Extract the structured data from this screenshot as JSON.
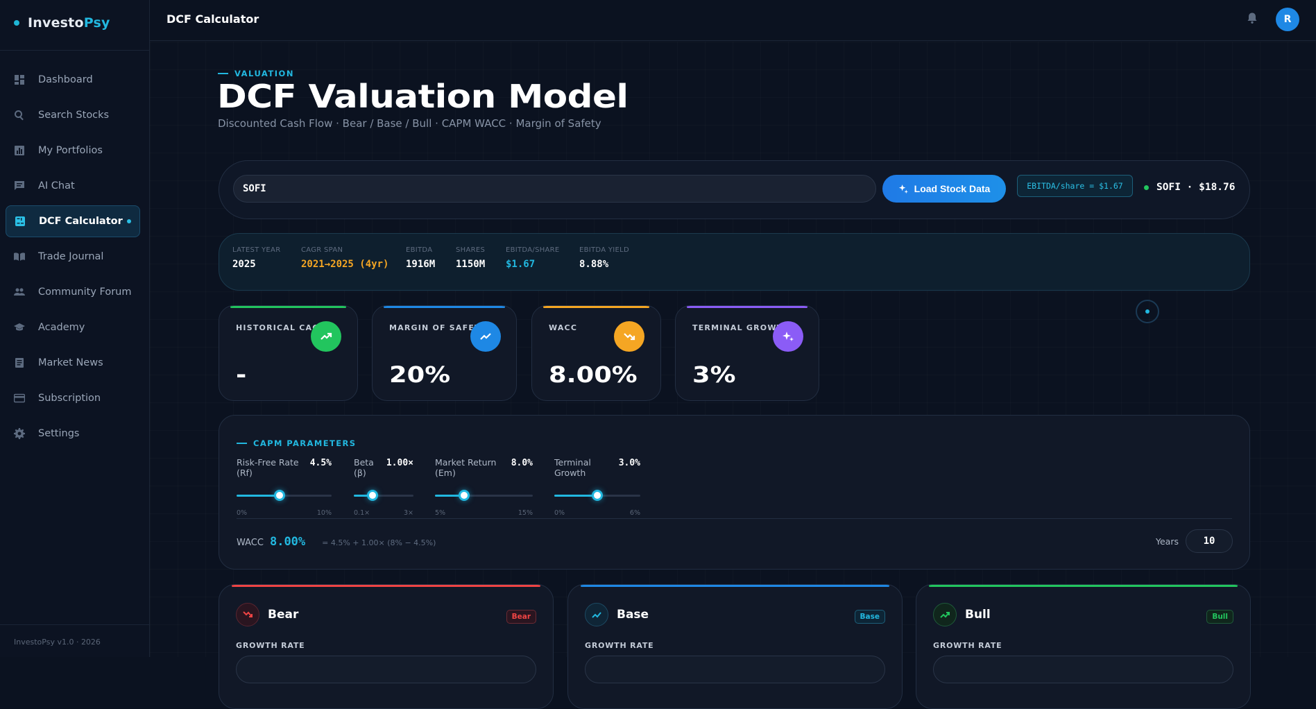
{
  "app": {
    "brand_prefix": "Investo",
    "brand_suffix": "Psy",
    "version": "InvestoPsy v1.0 · 2026"
  },
  "topbar": {
    "title": "DCF Calculator",
    "avatar_initial": "R"
  },
  "sidebar": {
    "items": [
      {
        "label": "Dashboard",
        "icon": "dashboard-icon"
      },
      {
        "label": "Search Stocks",
        "icon": "search-icon"
      },
      {
        "label": "My Portfolios",
        "icon": "bar-chart-icon"
      },
      {
        "label": "AI Chat",
        "icon": "chat-icon"
      },
      {
        "label": "DCF Calculator",
        "icon": "calculator-icon",
        "active": true
      },
      {
        "label": "Trade Journal",
        "icon": "book-icon"
      },
      {
        "label": "Community Forum",
        "icon": "people-icon"
      },
      {
        "label": "Academy",
        "icon": "graduation-cap-icon"
      },
      {
        "label": "Market News",
        "icon": "newspaper-icon"
      },
      {
        "label": "Subscription",
        "icon": "credit-card-icon"
      },
      {
        "label": "Settings",
        "icon": "gear-icon"
      }
    ]
  },
  "header": {
    "eyebrow": "VALUATION",
    "title": "DCF Valuation Model",
    "subtitle": "Discounted Cash Flow · Bear / Base / Bull · CAPM WACC · Margin of Safety"
  },
  "search": {
    "ticker_value": "SOFI",
    "load_label": "Load Stock Data",
    "ebitda_pill": "EBITDA/share = $1.67",
    "price_tag": "SOFI · $18.76"
  },
  "stats": [
    {
      "label": "LATEST YEAR",
      "value": "2025",
      "color": "#ffffff"
    },
    {
      "label": "CAGR SPAN",
      "value": "2021→2025 (4yr)",
      "color": "#f5a623"
    },
    {
      "label": "EBITDA",
      "value": "1916M",
      "color": "#ffffff"
    },
    {
      "label": "SHARES",
      "value": "1150M",
      "color": "#ffffff"
    },
    {
      "label": "EBITDA/SHARE",
      "value": "$1.67",
      "color": "#22b8e0"
    },
    {
      "label": "EBITDA YIELD",
      "value": "8.88%",
      "color": "#ffffff"
    }
  ],
  "metrics": [
    {
      "label": "HISTORICAL CAGR",
      "value": "-",
      "color": "#22c55e",
      "icon": "trending-up-icon"
    },
    {
      "label": "MARGIN OF SAFETY",
      "value": "20%",
      "color": "#1e88e5",
      "icon": "trending-up-icon"
    },
    {
      "label": "WACC",
      "value": "8.00%",
      "color": "#f5a623",
      "icon": "trending-down-icon"
    },
    {
      "label": "TERMINAL GROWTH",
      "value": "3%",
      "color": "#8b5cf6",
      "icon": "sparkle-icon"
    }
  ],
  "capm": {
    "title": "CAPM PARAMETERS",
    "sliders": [
      {
        "label": "Risk-Free Rate (Rf)",
        "value": "4.5%",
        "min": "0%",
        "max": "10%",
        "fraction": 0.45
      },
      {
        "label": "Beta (β)",
        "value": "1.00×",
        "min": "0.1×",
        "max": "3×",
        "fraction": 0.31
      },
      {
        "label": "Market Return (Em)",
        "value": "8.0%",
        "min": "5%",
        "max": "15%",
        "fraction": 0.3
      },
      {
        "label": "Terminal Growth",
        "value": "3.0%",
        "min": "0%",
        "max": "6%",
        "fraction": 0.5
      }
    ],
    "wacc_label": "WACC",
    "wacc_value": "8.00%",
    "wacc_formula": "= 4.5% + 1.00× (8% − 4.5%)",
    "years_label": "Years",
    "years_value": "10"
  },
  "scenarios": [
    {
      "name": "Bear",
      "badge": "Bear",
      "growth_label": "GROWTH RATE",
      "color": "#ef4444",
      "icon": "trending-down-icon"
    },
    {
      "name": "Base",
      "badge": "Base",
      "growth_label": "GROWTH RATE",
      "color": "#22b8e0",
      "icon": "trending-up-icon"
    },
    {
      "name": "Bull",
      "badge": "Bull",
      "growth_label": "GROWTH RATE",
      "color": "#22c55e",
      "icon": "trending-up-icon"
    }
  ]
}
